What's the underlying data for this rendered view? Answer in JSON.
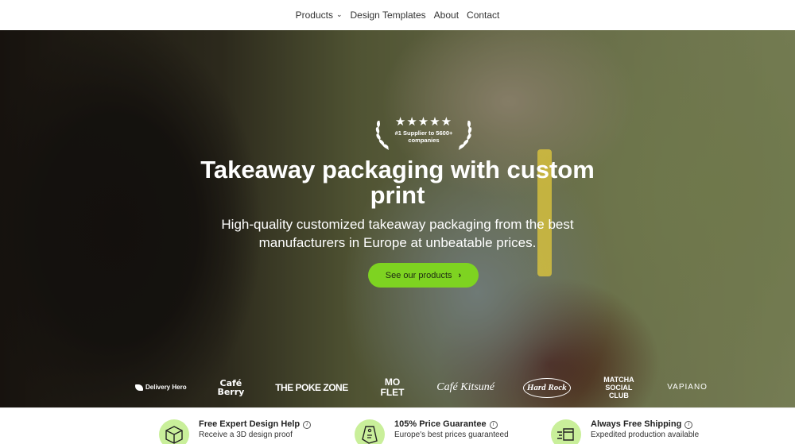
{
  "nav": {
    "items": [
      {
        "label": "Products",
        "has_dropdown": true
      },
      {
        "label": "Design Templates"
      },
      {
        "label": "About"
      },
      {
        "label": "Contact"
      }
    ],
    "dropdown_icon": "chevron-down-icon"
  },
  "hero": {
    "badge": {
      "stars": "★★★★★",
      "rating": 5,
      "text": "#1 Supplier to 5600+ companies",
      "icon": "laurel-wreath-icon"
    },
    "title": "Takeaway packaging with custom print",
    "subtitle": "High-quality customized takeaway packaging from the best manufacturers in Europe at unbeatable prices.",
    "cta_label": "See our products",
    "cta_icon": "chevron-right-icon",
    "cta_color": "#7ed321"
  },
  "logos": {
    "delivery_hero": "Delivery Hero",
    "cafe_berry": "Café Berry",
    "poke_zone": "THE POKE ZONE",
    "moflet": "MO FLET",
    "cafe_kitsune": "Café Kitsuné",
    "hard_rock": "Hard Rock",
    "matcha_social_club": "MATCHA SOCIAL CLUB",
    "vapiano": "VAPIANO"
  },
  "features": [
    {
      "icon": "box-3d-icon",
      "title": "Free Expert Design Help",
      "description": "Receive a 3D design proof"
    },
    {
      "icon": "price-tag-icon",
      "title": "105% Price Guarantee",
      "description": "Europe's best prices guaranteed"
    },
    {
      "icon": "fast-shipping-box-icon",
      "title": "Always Free Shipping",
      "description": "Expedited production available"
    }
  ],
  "colors": {
    "accent_green": "#7ed321",
    "icon_circle": "#c9ef9a"
  }
}
